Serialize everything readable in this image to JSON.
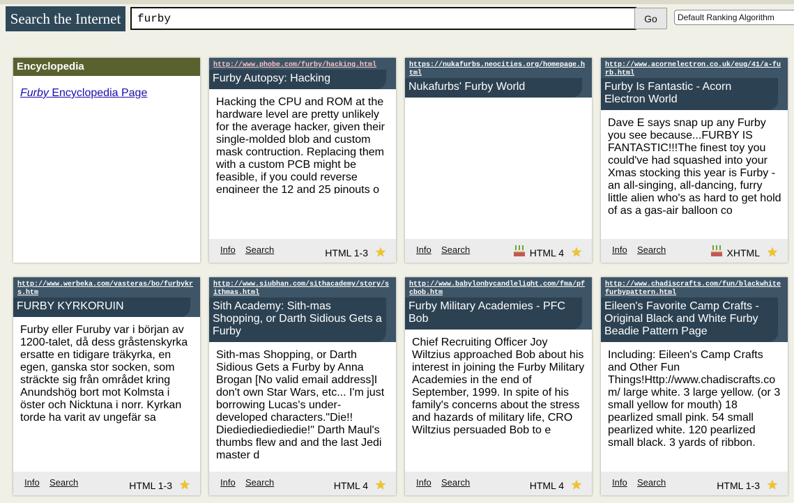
{
  "header": {
    "brand": "Search the Internet",
    "query": "furby",
    "go_label": "Go",
    "ranking": "Default Ranking Algorithm"
  },
  "encyclopedia": {
    "header": "Encyclopedia",
    "link_term": "Furby",
    "link_suffix": " Encyclopedia Page"
  },
  "footer_labels": {
    "info": "Info",
    "search": "Search"
  },
  "results": [
    {
      "url": "http://www.phobe.com/furby/hacking.html",
      "title": "Furby Autopsy: Hacking",
      "snippet": "Hacking the CPU and ROM at the hardware level are pretty unlikely for the average hacker, given their single-molded blob and custom mask contruction. Replacing them with a custom PCB might be feasible, if you could reverse engineer the 12 and 25 pinouts o",
      "format": "HTML 1-3",
      "cake": false
    },
    {
      "url": "https://nukafurbs.neocities.org/homepage.html",
      "title": "Nukafurbs' Furby World",
      "snippet": "",
      "format": "HTML 4",
      "cake": true
    },
    {
      "url": "http://www.acornelectron.co.uk/eug/41/a-furb.html",
      "title": "Furby Is Fantastic - Acorn Electron World",
      "snippet": "Dave E says snap up any Furby you see because...FURBY IS FANTASTIC!!!The finest toy you could've had squashed into your Xmas stocking this year is Furby - an all-singing, all-dancing, furry little alien who's as hard to get hold of as a gas-air balloon co",
      "format": "XHTML",
      "cake": true
    },
    {
      "url": "http://www.werbeka.com/vasteras/bo/furbykrs.htm",
      "title": "FURBY KYRKORUIN",
      "snippet": "Furby eller Furuby var i början av 1200-talet, då dess gråstenskyrka ersatte en tidigare träkyrka, en egen, ganska stor socken, som sträckte sig från området kring Anundshög bort mot Kolmsta i öster och Nicktuna i norr. Kyrkan torde ha varit av ungefär sa",
      "format": "HTML 1-3",
      "cake": false
    },
    {
      "url": "http://www.siubhan.com/sithacademy/story/sithmas.html",
      "title": "Sith Academy: Sith-mas Shopping, or Darth Sidious Gets a Furby",
      "snippet": "Sith-mas Shopping, or Darth Sidious Gets a Furby by Anna Brogan [No valid email address]I don't own Star Wars, etc... I'm just borrowing Lucas's under-developed characters.\"Die!! Diediediediediedie!\" Darth Maul's thumbs flew and and the last Jedi master d",
      "format": "HTML 4",
      "cake": false
    },
    {
      "url": "http://www.babylonbycandlelight.com/fma/pfcbob.htm",
      "title": "Furby Military Academies - PFC Bob",
      "snippet": "Chief Recruiting Officer Joy Wiltzius approached Bob about his interest in joining the Furby Military Academies in the end of September, 1999. In spite of his family's concerns about the stress and hazards of military life, CRO Wiltzius persuaded Bob to e",
      "format": "HTML 4",
      "cake": false
    },
    {
      "url": "http://www.chadiscrafts.com/fun/blackwhitefurbypattern.html",
      "title": "Eileen's Favorite Camp Crafts - Original Black and White Furby Beadie Pattern Page",
      "snippet": "Including: Eileen's Camp Crafts and Other Fun Things!Http://www.chadiscrafts.com/ large white. 3 large yellow. (or 3 small yellow for mouth) 18 pearlized small pink. 54 small pearlized white. 120 pearlized small black. 3 yards of ribbon.",
      "format": "HTML 1-3",
      "cake": false
    }
  ]
}
